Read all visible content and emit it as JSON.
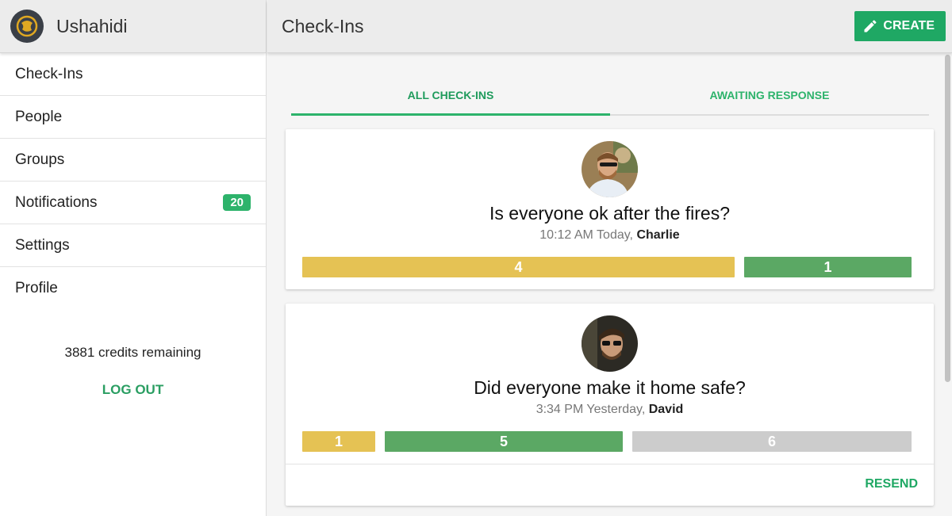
{
  "app": {
    "name": "Ushahidi"
  },
  "sidebar": {
    "items": [
      {
        "label": "Check-Ins"
      },
      {
        "label": "People"
      },
      {
        "label": "Groups"
      },
      {
        "label": "Notifications",
        "badge": "20"
      },
      {
        "label": "Settings"
      },
      {
        "label": "Profile"
      }
    ],
    "credits": "3881 credits remaining",
    "logout": "LOG OUT"
  },
  "header": {
    "title": "Check-Ins",
    "create_label": "CREATE"
  },
  "tabs": [
    {
      "label": "ALL CHECK-INS",
      "active": true
    },
    {
      "label": "AWAITING RESPONSE",
      "active": false
    }
  ],
  "checkins": [
    {
      "question": "Is everyone ok after the fires?",
      "time": "10:12 AM Today,",
      "author": "Charlie",
      "bars": [
        {
          "value": "4",
          "color": "#e5c254"
        },
        {
          "value": "1",
          "color": "#5ba864"
        }
      ]
    },
    {
      "question": "Did everyone make it home safe?",
      "time": "3:34 PM Yesterday,",
      "author": "David",
      "bars": [
        {
          "value": "1",
          "color": "#e5c254"
        },
        {
          "value": "5",
          "color": "#5ba864"
        },
        {
          "value": "6",
          "color": "#cccccc"
        }
      ],
      "action": "RESEND"
    }
  ],
  "colors": {
    "accent": "#1fa864",
    "yes": "#5ba864",
    "warn": "#e5c254",
    "pending": "#cccccc"
  }
}
